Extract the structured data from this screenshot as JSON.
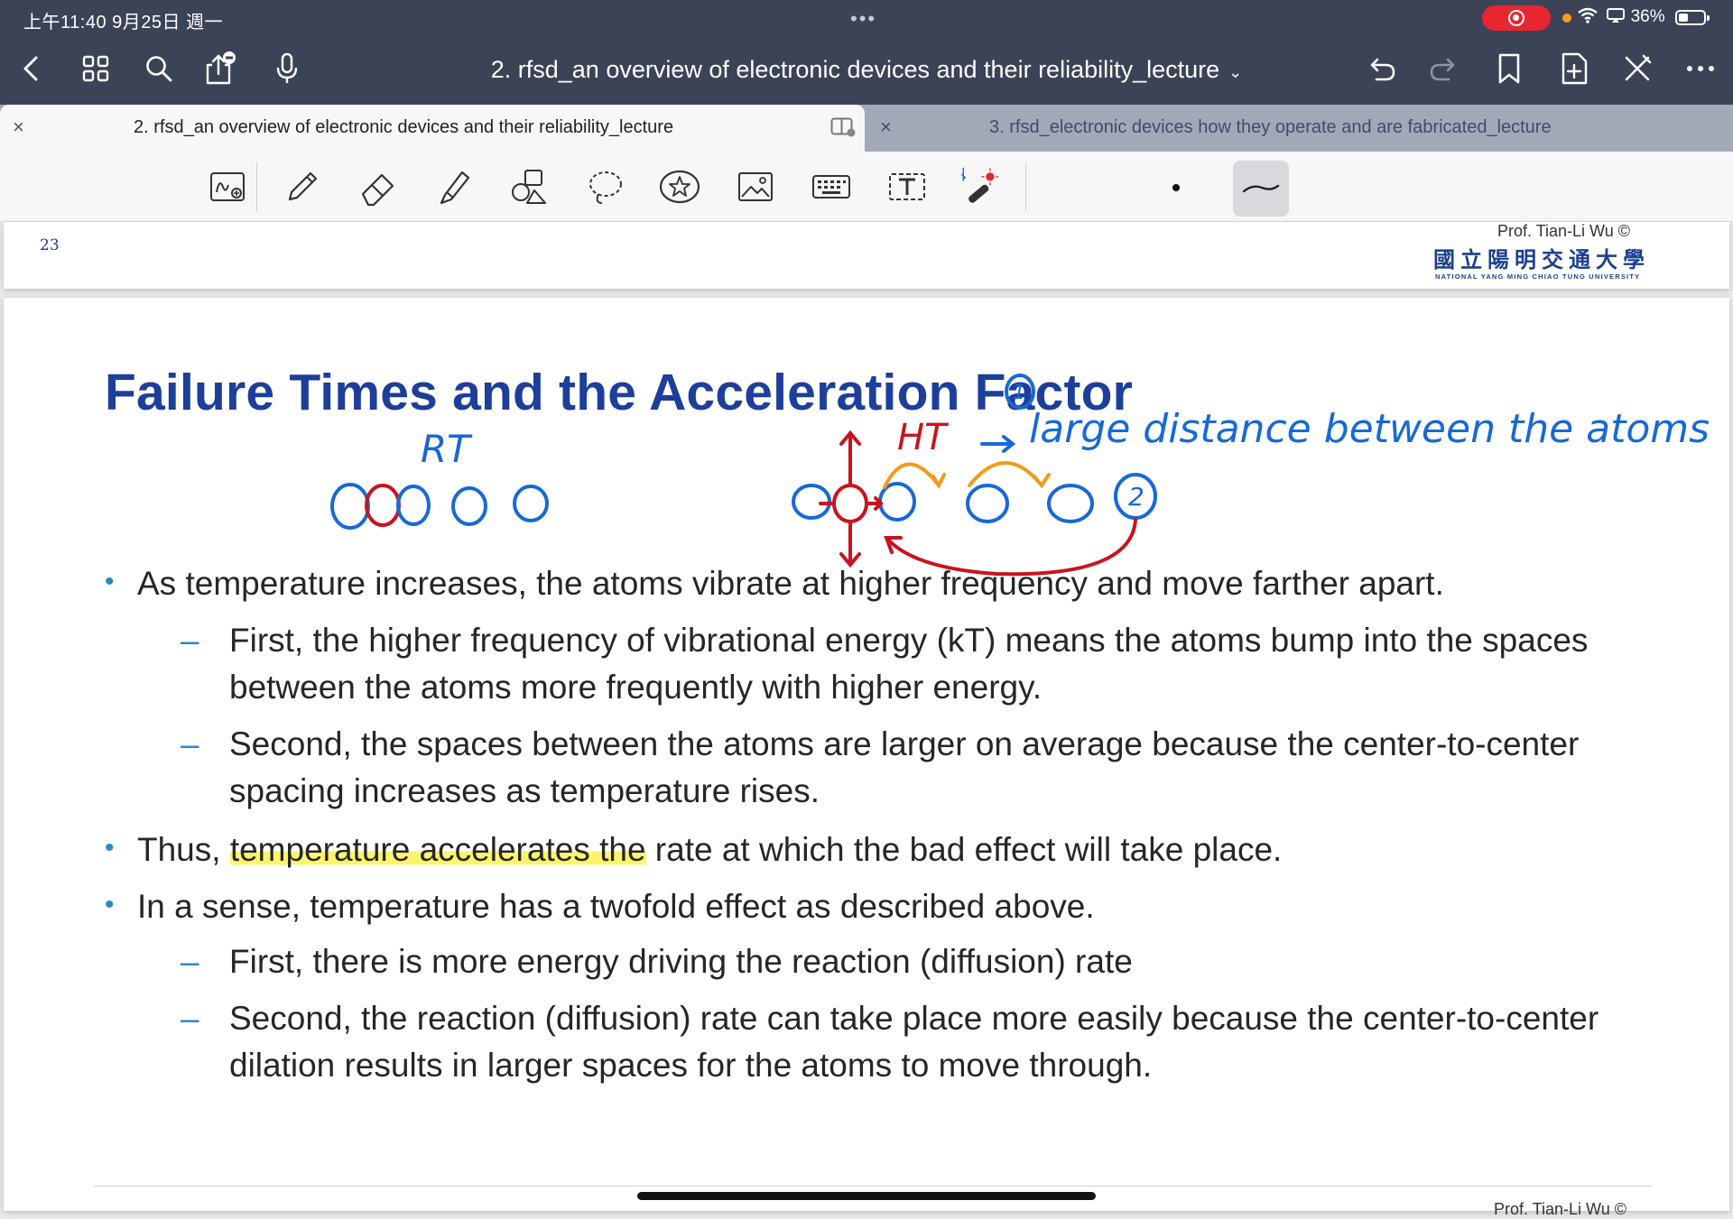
{
  "status": {
    "time": "上午11:40   9月25日 週一",
    "battery": "36%",
    "dots": "•••"
  },
  "nav": {
    "title": "2. rfsd_an overview of electronic devices and their reliability_lecture",
    "title_chevron": "⌄"
  },
  "tabs": [
    {
      "label": "2. rfsd_an overview of electronic devices and their reliability_lecture",
      "close": "×"
    },
    {
      "label": "3. rfsd_electronic devices how they operate and are fabricated_lecture",
      "close": "×"
    }
  ],
  "prev_page": {
    "number": "23",
    "author": "Prof. Tian-Li Wu ©",
    "university_cn": "國立陽明交通大學",
    "university_en": "NATIONAL YANG MING CHIAO TUNG UNIVERSITY"
  },
  "slide": {
    "title": "Failure Times and the Acceleration Factor",
    "bullets": [
      {
        "text": "As temperature increases, the atoms vibrate at higher frequency and move farther apart.",
        "subs": [
          "First, the higher frequency of vibrational energy (kT) means the atoms bump into the spaces between the atoms more frequently with higher energy.",
          "Second, the spaces between the atoms are larger on average because the center-to-center spacing increases as temperature rises."
        ]
      },
      {
        "text_before": "Thus, ",
        "text_highlight": "temperature accelerates the",
        "text_after": " rate at which the bad effect will take place."
      },
      {
        "text": "In a sense, temperature has a twofold effect as described above.",
        "subs": [
          "First, there is more energy driving the reaction (diffusion) rate",
          "Second, the reaction (diffusion) rate can take place more easily because the center-to-center dilation results in larger spaces for the atoms to move through."
        ]
      }
    ],
    "bullet_glyph": "•",
    "dash_glyph": "–",
    "footer_author": "Prof. Tian-Li Wu ©"
  },
  "annotations": {
    "rt_label": "RT",
    "ht_label": "HT",
    "distance_note": "large distance between the atoms",
    "circle_1": "1",
    "circle_2": "2",
    "highlight_color": "#faf03c",
    "blue_ink": "#1769d6",
    "red_ink": "#c8141e",
    "orange_ink": "#f29a1a"
  },
  "colors": {
    "header_bg": "#3d4356",
    "title_blue": "#1d3f9b",
    "bullet_blue": "#2f87c4",
    "record_red": "#e8262f"
  }
}
